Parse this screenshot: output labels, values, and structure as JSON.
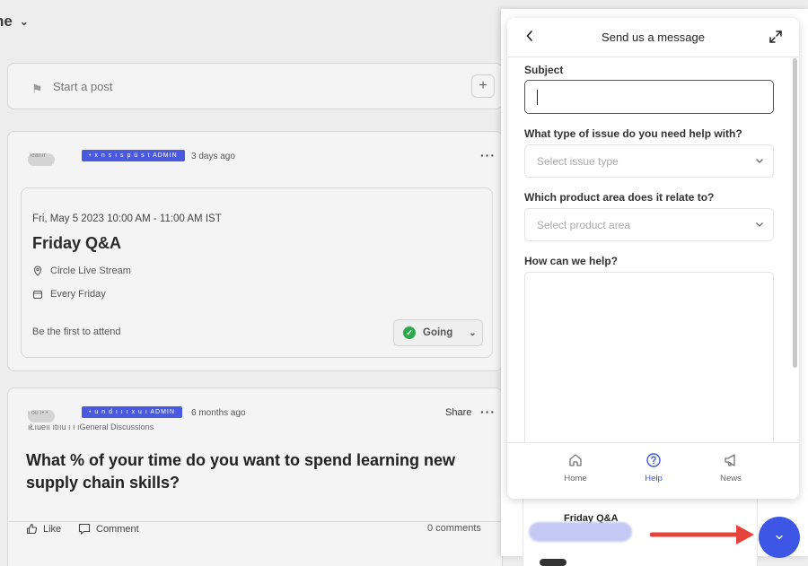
{
  "feed": {
    "space_title": "ne",
    "start_post": "Start a post",
    "event_post": {
      "author_blur": "ıeanır",
      "badge": "• x n s  ı s  p ü s t  ADMIN",
      "time": "3 days ago",
      "date": "Fri, May 5 2023 10:00 AM - 11:00 AM IST",
      "title": "Friday Q&A",
      "location": "Circle Live Stream",
      "recurrence": "Every Friday",
      "first_attend": "Be the first to attend",
      "rsvp": "Going"
    },
    "question_post": {
      "author_blur": "ı ou ı• •",
      "badge": "• u n d  ı  ı ı x u ı  ADMIN",
      "time": "6 months ago",
      "share": "Share",
      "subtitle": "ıŁıueıı ıtııu ı ı ıGeneral Discussions",
      "title": "What % of your time do you want to spend learning new supply chain skills?",
      "like": "Like",
      "comment": "Comment",
      "comments_count": "0 comments"
    }
  },
  "widget": {
    "title": "Send us a message",
    "subject_label": "Subject",
    "subject_value": "",
    "issue_label": "What type of issue do you need help with?",
    "issue_placeholder": "Select issue type",
    "area_label": "Which product area does it relate to?",
    "area_placeholder": "Select product area",
    "help_label": "How can we help?",
    "help_value": "",
    "nav": [
      {
        "label": "Home",
        "icon": "home-icon"
      },
      {
        "label": "Help",
        "icon": "help-icon",
        "active": true
      },
      {
        "label": "News",
        "icon": "megaphone-icon"
      }
    ]
  },
  "behind_widget": {
    "title": "Friday Q&A"
  },
  "colors": {
    "accent": "#3d56e6",
    "annotation_arrow": "#e8433a",
    "going_check": "#2ea84e"
  }
}
